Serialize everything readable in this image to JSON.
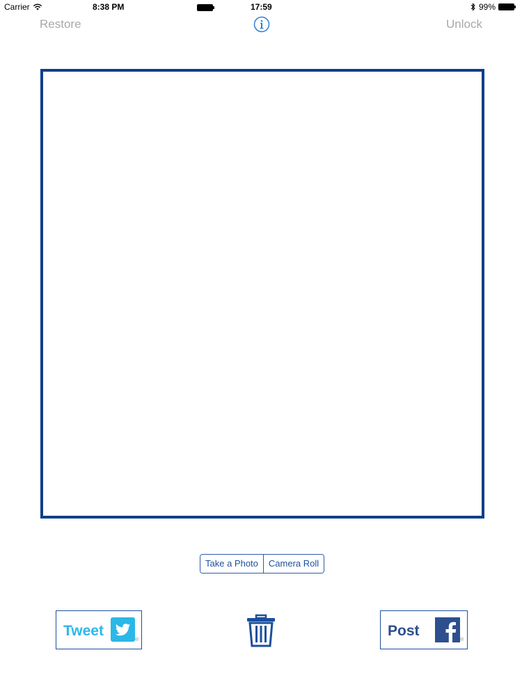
{
  "status_bar": {
    "carrier": "Carrier",
    "time_left": "8:38 PM",
    "time_center": "17:59",
    "battery_percent": "99%"
  },
  "nav": {
    "restore_label": "Restore",
    "unlock_label": "Unlock"
  },
  "source_selector": {
    "take_photo_label": "Take a Photo",
    "camera_roll_label": "Camera Roll"
  },
  "share": {
    "tweet_label": "Tweet",
    "post_label": "Post",
    "registered_mark": "®"
  },
  "colors": {
    "frame_blue": "#0e3f8a",
    "control_blue": "#1c4f9c",
    "twitter_blue": "#2ab8e8",
    "facebook_blue": "#2d4f8e",
    "disabled_gray": "#a8a8a8"
  },
  "icons": [
    "wifi-icon",
    "battery-icon",
    "bluetooth-icon",
    "info-icon",
    "twitter-bird-icon",
    "trash-icon",
    "facebook-icon"
  ]
}
